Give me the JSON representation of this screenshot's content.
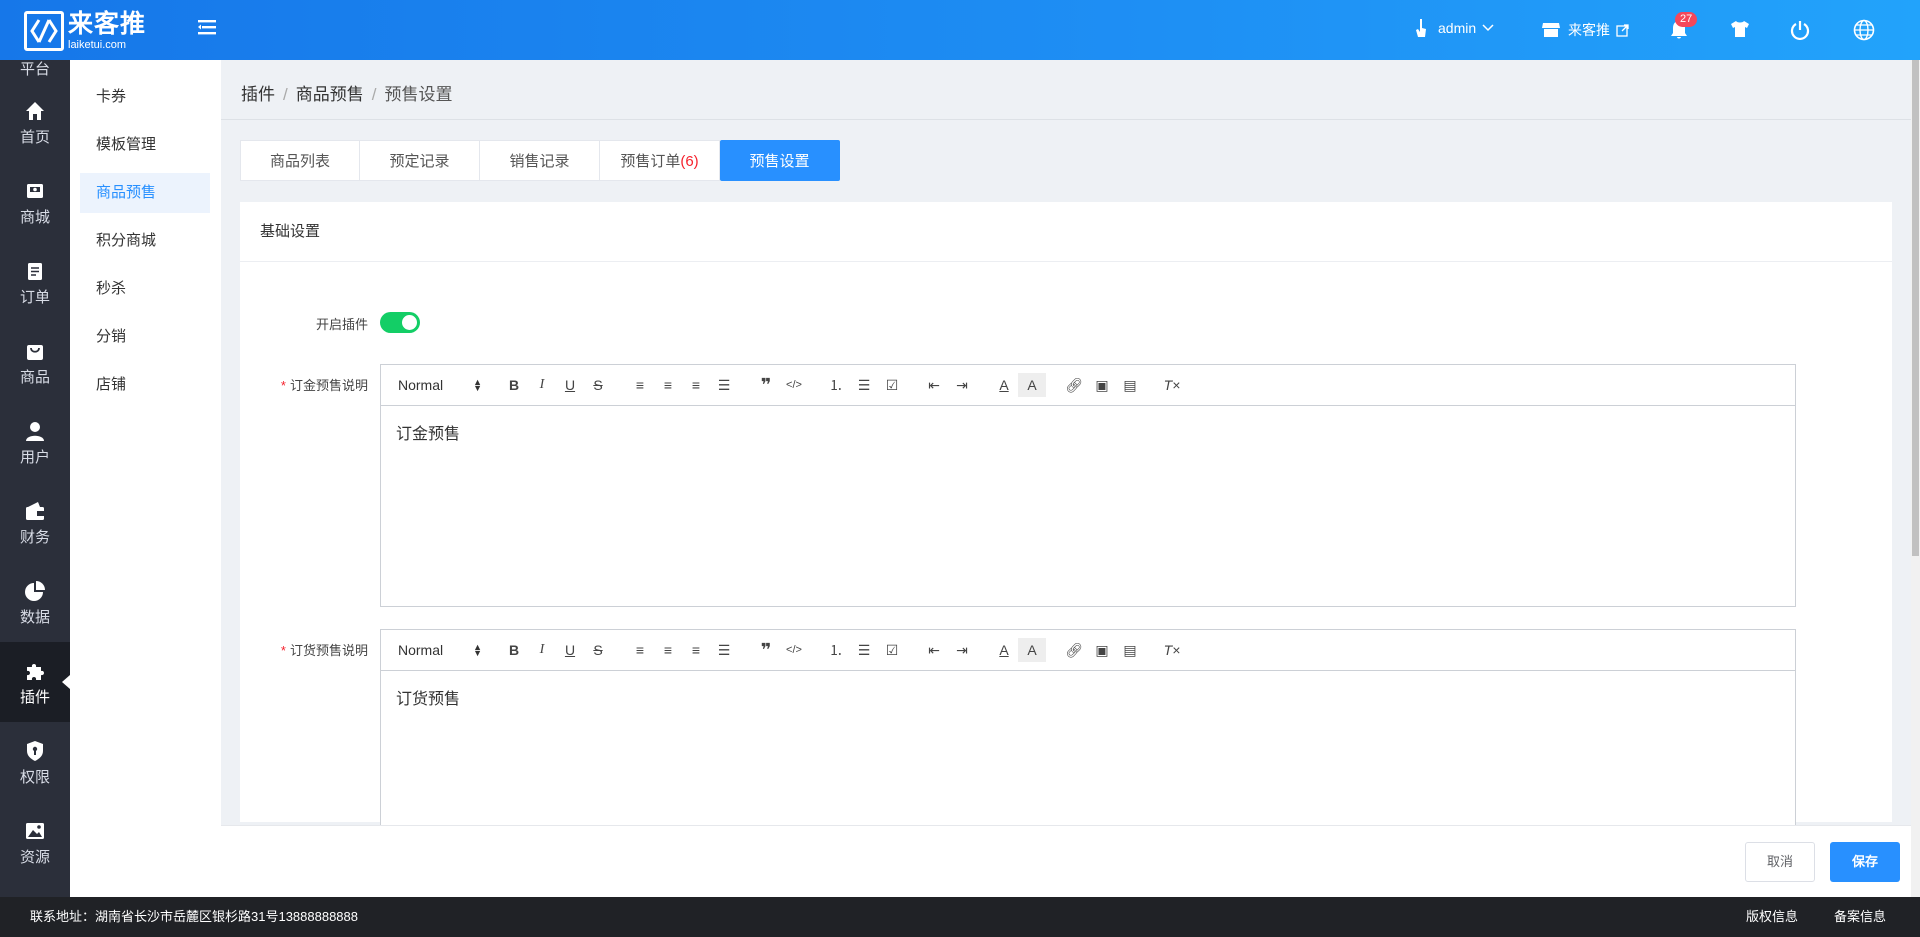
{
  "header": {
    "logo_cn": "来客推",
    "logo_en": "laiketui.com",
    "user": "admin",
    "shop": "来客推",
    "notification_count": "27"
  },
  "leftnav": {
    "top_partial": "平台",
    "items": [
      {
        "label": "首页",
        "icon": "home-icon"
      },
      {
        "label": "商城",
        "icon": "store-icon"
      },
      {
        "label": "订单",
        "icon": "order-icon"
      },
      {
        "label": "商品",
        "icon": "bag-icon"
      },
      {
        "label": "用户",
        "icon": "user-icon"
      },
      {
        "label": "财务",
        "icon": "wallet-icon"
      },
      {
        "label": "数据",
        "icon": "pie-chart-icon"
      },
      {
        "label": "插件",
        "icon": "puzzle-icon"
      },
      {
        "label": "权限",
        "icon": "shield-icon"
      },
      {
        "label": "资源",
        "icon": "image-icon"
      }
    ],
    "active": "插件"
  },
  "submenu": {
    "items": [
      "卡券",
      "模板管理",
      "商品预售",
      "积分商城",
      "秒杀",
      "分销",
      "店铺"
    ],
    "active": "商品预售"
  },
  "breadcrumb": [
    "插件",
    "商品预售",
    "预售设置"
  ],
  "tabs": [
    {
      "label": "商品列表"
    },
    {
      "label": "预定记录"
    },
    {
      "label": "销售记录"
    },
    {
      "label": "预售订单",
      "count": "(6)"
    },
    {
      "label": "预售设置"
    }
  ],
  "active_tab": "预售设置",
  "card": {
    "title": "基础设置",
    "switch_label": "开启插件",
    "switch_on": true,
    "deposit_label": "订金预售说明",
    "deposit_text": "订金预售",
    "order_label": "订货预售说明",
    "order_text": "订货预售",
    "format_select": "Normal"
  },
  "actions": {
    "cancel": "取消",
    "save": "保存"
  },
  "footer": {
    "address": "联系地址：湖南省长沙市岳麓区银杉路31号13888888888",
    "copyright": "版权信息",
    "record": "备案信息"
  },
  "colors": {
    "primary": "#2890ff",
    "switch_on": "#13ce66",
    "danger": "#f5222d",
    "nav_bg": "#2b2f3a"
  }
}
